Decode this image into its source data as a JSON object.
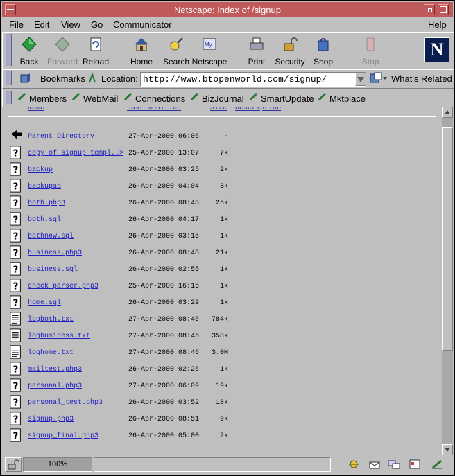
{
  "window": {
    "title": "Netscape: Index of /signup"
  },
  "menu": [
    "File",
    "Edit",
    "View",
    "Go",
    "Communicator",
    "Help"
  ],
  "toolbar": [
    {
      "label": "Back",
      "icon": "back-arrow-icon",
      "enabled": true
    },
    {
      "label": "Forward",
      "icon": "forward-arrow-icon",
      "enabled": false
    },
    {
      "label": "Reload",
      "icon": "reload-icon",
      "enabled": true
    },
    {
      "label": "Home",
      "icon": "home-icon",
      "enabled": true
    },
    {
      "label": "Search",
      "icon": "search-icon",
      "enabled": true
    },
    {
      "label": "Netscape",
      "icon": "netscape-icon",
      "enabled": true
    },
    {
      "label": "Print",
      "icon": "print-icon",
      "enabled": true
    },
    {
      "label": "Security",
      "icon": "lock-icon",
      "enabled": true
    },
    {
      "label": "Shop",
      "icon": "shop-icon",
      "enabled": true
    },
    {
      "label": "Stop",
      "icon": "stop-icon",
      "enabled": false
    }
  ],
  "logo": {
    "letter": "N"
  },
  "location": {
    "bookmarks_label": "Bookmarks",
    "location_label": "Location:",
    "url": "http://www.btopenworld.com/signup/",
    "whats_related": "What's Related"
  },
  "personal_toolbar": [
    "Members",
    "WebMail",
    "Connections",
    "BizJournal",
    "SmartUpdate",
    "Mktplace"
  ],
  "listing": {
    "headers": [
      "Name",
      "Last modified",
      "Size",
      "Description"
    ],
    "rows": [
      {
        "name": "Parent Directory",
        "date": "27-Apr-2000 06:06",
        "size": "-",
        "icon": "parent-dir"
      },
      {
        "name": "copy_of_signup_templ..>",
        "date": "25-Apr-2000 13:07",
        "size": "7k",
        "icon": "unknown"
      },
      {
        "name": "backup",
        "date": "26-Apr-2000 03:25",
        "size": "2k",
        "icon": "unknown"
      },
      {
        "name": "backupab",
        "date": "26-Apr-2000 04:04",
        "size": "3k",
        "icon": "unknown"
      },
      {
        "name": "both.php3",
        "date": "26-Apr-2000 08:48",
        "size": "25k",
        "icon": "unknown"
      },
      {
        "name": "both.sql",
        "date": "26-Apr-2000 04:17",
        "size": "1k",
        "icon": "unknown"
      },
      {
        "name": "bothnew.sql",
        "date": "26-Apr-2000 03:15",
        "size": "1k",
        "icon": "unknown"
      },
      {
        "name": "business.php3",
        "date": "26-Apr-2000 08:48",
        "size": "21k",
        "icon": "unknown"
      },
      {
        "name": "business.sql",
        "date": "26-Apr-2000 02:55",
        "size": "1k",
        "icon": "unknown"
      },
      {
        "name": "check_parser.php3",
        "date": "25-Apr-2000 16:15",
        "size": "1k",
        "icon": "unknown"
      },
      {
        "name": "home.sql",
        "date": "26-Apr-2000 03:29",
        "size": "1k",
        "icon": "unknown"
      },
      {
        "name": "logboth.txt",
        "date": "27-Apr-2000 08:46",
        "size": "784k",
        "icon": "text"
      },
      {
        "name": "logbusiness.txt",
        "date": "27-Apr-2000 08:45",
        "size": "358k",
        "icon": "text"
      },
      {
        "name": "loghome.txt",
        "date": "27-Apr-2000 08:46",
        "size": "3.0M",
        "icon": "text"
      },
      {
        "name": "mailtest.php3",
        "date": "26-Apr-2000 02:26",
        "size": "1k",
        "icon": "unknown"
      },
      {
        "name": "personal.php3",
        "date": "27-Apr-2000 06:09",
        "size": "19k",
        "icon": "unknown"
      },
      {
        "name": "personal_test.php3",
        "date": "26-Apr-2000 03:52",
        "size": "18k",
        "icon": "unknown"
      },
      {
        "name": "signup.php3",
        "date": "26-Apr-2000 08:51",
        "size": "9k",
        "icon": "unknown"
      },
      {
        "name": "signup_final.php3",
        "date": "26-Apr-2000 05:00",
        "size": "2k",
        "icon": "unknown"
      }
    ]
  },
  "status": {
    "progress_text": "100%"
  },
  "colors": {
    "titlebar": "#c05a5a",
    "link": "#2020c0",
    "chrome": "#c0c0c0"
  }
}
